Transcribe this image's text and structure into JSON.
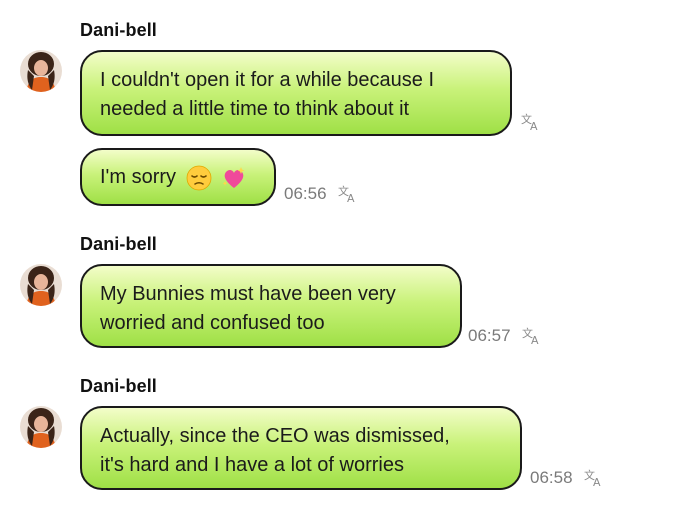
{
  "messages": [
    {
      "sender": "Dani-bell",
      "bubbles": [
        {
          "lines": [
            "I couldn't open it for a while because I",
            "needed a little time to think about it"
          ],
          "time": "",
          "translate_icon": "translate-icon"
        },
        {
          "lines": [
            "I'm sorry"
          ],
          "emojis": [
            "pensive-face-emoji",
            "sparkling-heart-emoji"
          ],
          "time": "06:56",
          "translate_icon": "translate-icon"
        }
      ]
    },
    {
      "sender": "Dani-bell",
      "bubbles": [
        {
          "lines": [
            "My Bunnies must have been very",
            "worried and confused too"
          ],
          "time": "06:57",
          "translate_icon": "translate-icon"
        }
      ]
    },
    {
      "sender": "Dani-bell",
      "bubbles": [
        {
          "lines": [
            "Actually, since the CEO was dismissed,",
            "it's hard and I have a lot of worries"
          ],
          "time": "06:58",
          "translate_icon": "translate-icon"
        }
      ]
    }
  ],
  "colors": {
    "bubble_top": "#f3fdc9",
    "bubble_bottom": "#9fe046",
    "bubble_border": "#1a1a1a",
    "timestamp": "#7a7a7a"
  }
}
